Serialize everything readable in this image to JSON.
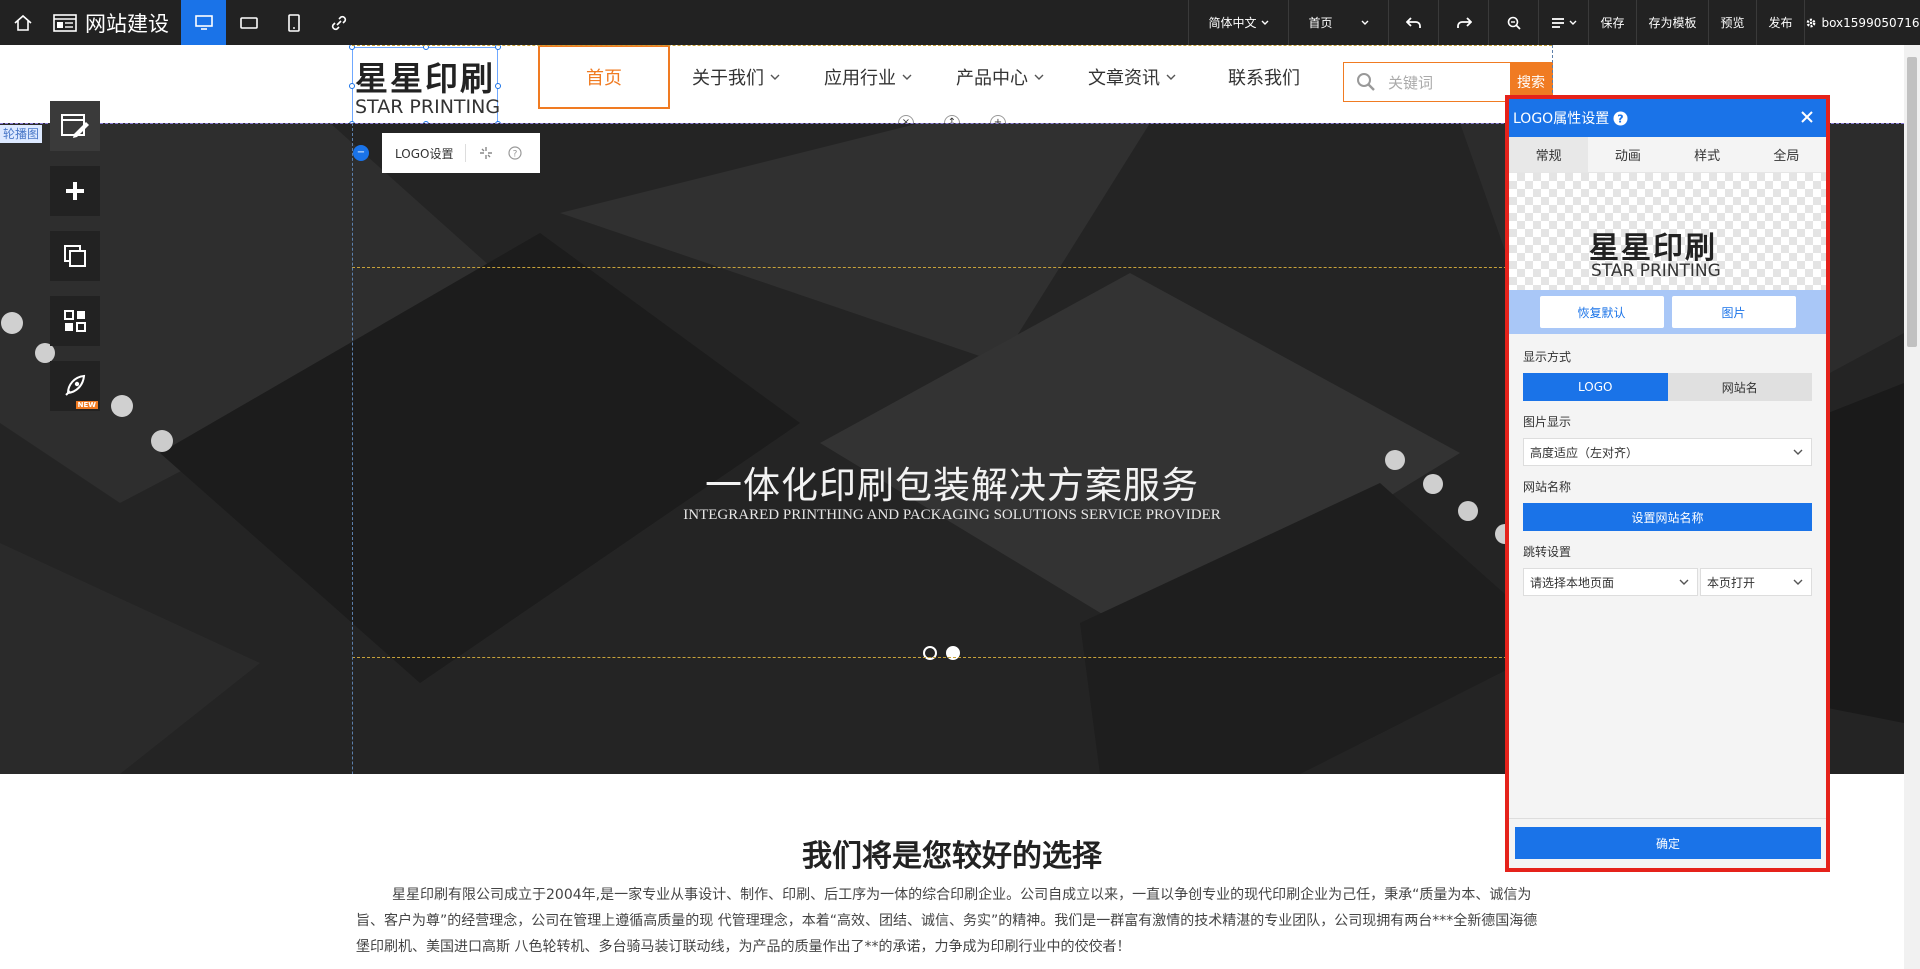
{
  "topbar": {
    "brand": "网站建设",
    "language": "简体中文",
    "page": "首页",
    "save": "保存",
    "save_template": "存为模板",
    "preview": "预览",
    "publish": "发布",
    "account": "box1599050716"
  },
  "site": {
    "logo_cn": "星星印刷",
    "logo_en": "STAR PRINTING",
    "nav": [
      "首页",
      "关于我们",
      "应用行业",
      "产品中心",
      "文章资讯",
      "联系我们"
    ],
    "search_placeholder": "关键词",
    "search_button": "搜索",
    "carousel_tag": "轮播图",
    "logo_toolbar_label": "LOGO设置",
    "banner_title": "一体化印刷包装解决方案服务",
    "banner_subtitle": "INTEGRARED PRINTHING AND PACKAGING SOLUTIONS SERVICE PROVIDER",
    "section_title": "我们将是您较好的选择",
    "section_text": "星星印刷有限公司成立于2004年,是一家专业从事设计、制作、印刷、后工序为一体的综合印刷企业。公司自成立以来，一直以争创专业的现代印刷企业为己任，秉承“质量为本、诚信为旨、客户为尊”的经营理念，公司在管理上遵循高质量的现 代管理理念，本着“高效、团结、诚信、务实”的精神。我们是一群富有激情的技术精湛的专业团队，公司现拥有两台***全新德国海德堡印刷机、美国进口高斯 八色轮转机、多台骑马装订联动线，为产品的质量作出了**的承诺，力争成为印刷行业中的佼佼者！"
  },
  "panel": {
    "title": "LOGO属性设置",
    "tabs": [
      "常规",
      "动画",
      "样式",
      "全局"
    ],
    "preview_cn": "星星印刷",
    "preview_en": "STAR PRINTING",
    "restore_default": "恢复默认",
    "image_button": "图片",
    "display_mode_label": "显示方式",
    "display_mode_options": [
      "LOGO",
      "网站名"
    ],
    "image_display_label": "图片显示",
    "image_display_value": "高度适应（左对齐）",
    "site_name_label": "网站名称",
    "site_name_button": "设置网站名称",
    "jump_label": "跳转设置",
    "jump_page": "请选择本地页面",
    "jump_target": "本页打开",
    "confirm": "确定"
  },
  "colors": {
    "accent": "#1a73e8",
    "brand_orange": "#f07b22",
    "highlight_border": "#e5221b",
    "topbar": "#222222"
  },
  "icons": [
    "home-icon",
    "website-builder-icon",
    "desktop-icon",
    "tablet-icon",
    "mobile-icon",
    "link-icon",
    "undo-icon",
    "redo-icon",
    "zoom-icon",
    "page-list-icon",
    "gear-icon",
    "search-icon",
    "close-icon",
    "help-icon",
    "edit-icon",
    "add-icon",
    "copy-icon",
    "layout-icon",
    "rocket-icon"
  ]
}
